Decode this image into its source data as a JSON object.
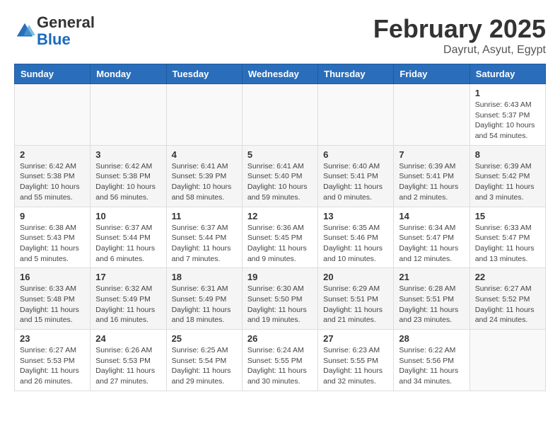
{
  "logo": {
    "line1": "General",
    "line2": "Blue"
  },
  "header": {
    "month_year": "February 2025",
    "location": "Dayrut, Asyut, Egypt"
  },
  "weekdays": [
    "Sunday",
    "Monday",
    "Tuesday",
    "Wednesday",
    "Thursday",
    "Friday",
    "Saturday"
  ],
  "weeks": [
    [
      {
        "day": "",
        "info": ""
      },
      {
        "day": "",
        "info": ""
      },
      {
        "day": "",
        "info": ""
      },
      {
        "day": "",
        "info": ""
      },
      {
        "day": "",
        "info": ""
      },
      {
        "day": "",
        "info": ""
      },
      {
        "day": "1",
        "info": "Sunrise: 6:43 AM\nSunset: 5:37 PM\nDaylight: 10 hours\nand 54 minutes."
      }
    ],
    [
      {
        "day": "2",
        "info": "Sunrise: 6:42 AM\nSunset: 5:38 PM\nDaylight: 10 hours\nand 55 minutes."
      },
      {
        "day": "3",
        "info": "Sunrise: 6:42 AM\nSunset: 5:38 PM\nDaylight: 10 hours\nand 56 minutes."
      },
      {
        "day": "4",
        "info": "Sunrise: 6:41 AM\nSunset: 5:39 PM\nDaylight: 10 hours\nand 58 minutes."
      },
      {
        "day": "5",
        "info": "Sunrise: 6:41 AM\nSunset: 5:40 PM\nDaylight: 10 hours\nand 59 minutes."
      },
      {
        "day": "6",
        "info": "Sunrise: 6:40 AM\nSunset: 5:41 PM\nDaylight: 11 hours\nand 0 minutes."
      },
      {
        "day": "7",
        "info": "Sunrise: 6:39 AM\nSunset: 5:41 PM\nDaylight: 11 hours\nand 2 minutes."
      },
      {
        "day": "8",
        "info": "Sunrise: 6:39 AM\nSunset: 5:42 PM\nDaylight: 11 hours\nand 3 minutes."
      }
    ],
    [
      {
        "day": "9",
        "info": "Sunrise: 6:38 AM\nSunset: 5:43 PM\nDaylight: 11 hours\nand 5 minutes."
      },
      {
        "day": "10",
        "info": "Sunrise: 6:37 AM\nSunset: 5:44 PM\nDaylight: 11 hours\nand 6 minutes."
      },
      {
        "day": "11",
        "info": "Sunrise: 6:37 AM\nSunset: 5:44 PM\nDaylight: 11 hours\nand 7 minutes."
      },
      {
        "day": "12",
        "info": "Sunrise: 6:36 AM\nSunset: 5:45 PM\nDaylight: 11 hours\nand 9 minutes."
      },
      {
        "day": "13",
        "info": "Sunrise: 6:35 AM\nSunset: 5:46 PM\nDaylight: 11 hours\nand 10 minutes."
      },
      {
        "day": "14",
        "info": "Sunrise: 6:34 AM\nSunset: 5:47 PM\nDaylight: 11 hours\nand 12 minutes."
      },
      {
        "day": "15",
        "info": "Sunrise: 6:33 AM\nSunset: 5:47 PM\nDaylight: 11 hours\nand 13 minutes."
      }
    ],
    [
      {
        "day": "16",
        "info": "Sunrise: 6:33 AM\nSunset: 5:48 PM\nDaylight: 11 hours\nand 15 minutes."
      },
      {
        "day": "17",
        "info": "Sunrise: 6:32 AM\nSunset: 5:49 PM\nDaylight: 11 hours\nand 16 minutes."
      },
      {
        "day": "18",
        "info": "Sunrise: 6:31 AM\nSunset: 5:49 PM\nDaylight: 11 hours\nand 18 minutes."
      },
      {
        "day": "19",
        "info": "Sunrise: 6:30 AM\nSunset: 5:50 PM\nDaylight: 11 hours\nand 19 minutes."
      },
      {
        "day": "20",
        "info": "Sunrise: 6:29 AM\nSunset: 5:51 PM\nDaylight: 11 hours\nand 21 minutes."
      },
      {
        "day": "21",
        "info": "Sunrise: 6:28 AM\nSunset: 5:51 PM\nDaylight: 11 hours\nand 23 minutes."
      },
      {
        "day": "22",
        "info": "Sunrise: 6:27 AM\nSunset: 5:52 PM\nDaylight: 11 hours\nand 24 minutes."
      }
    ],
    [
      {
        "day": "23",
        "info": "Sunrise: 6:27 AM\nSunset: 5:53 PM\nDaylight: 11 hours\nand 26 minutes."
      },
      {
        "day": "24",
        "info": "Sunrise: 6:26 AM\nSunset: 5:53 PM\nDaylight: 11 hours\nand 27 minutes."
      },
      {
        "day": "25",
        "info": "Sunrise: 6:25 AM\nSunset: 5:54 PM\nDaylight: 11 hours\nand 29 minutes."
      },
      {
        "day": "26",
        "info": "Sunrise: 6:24 AM\nSunset: 5:55 PM\nDaylight: 11 hours\nand 30 minutes."
      },
      {
        "day": "27",
        "info": "Sunrise: 6:23 AM\nSunset: 5:55 PM\nDaylight: 11 hours\nand 32 minutes."
      },
      {
        "day": "28",
        "info": "Sunrise: 6:22 AM\nSunset: 5:56 PM\nDaylight: 11 hours\nand 34 minutes."
      },
      {
        "day": "",
        "info": ""
      }
    ]
  ]
}
